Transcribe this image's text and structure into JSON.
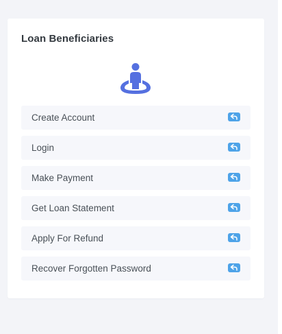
{
  "card": {
    "title": "Loan Beneficiaries",
    "hero_icon": "person-location-icon",
    "accent_color": "#5570e0",
    "badge_color": "#4ea3e8"
  },
  "actions": [
    {
      "label": "Create Account",
      "icon": "reply-icon"
    },
    {
      "label": "Login",
      "icon": "reply-icon"
    },
    {
      "label": "Make Payment",
      "icon": "reply-icon"
    },
    {
      "label": "Get Loan Statement",
      "icon": "reply-icon"
    },
    {
      "label": "Apply For Refund",
      "icon": "reply-icon"
    },
    {
      "label": "Recover Forgotten Password",
      "icon": "reply-icon"
    }
  ]
}
